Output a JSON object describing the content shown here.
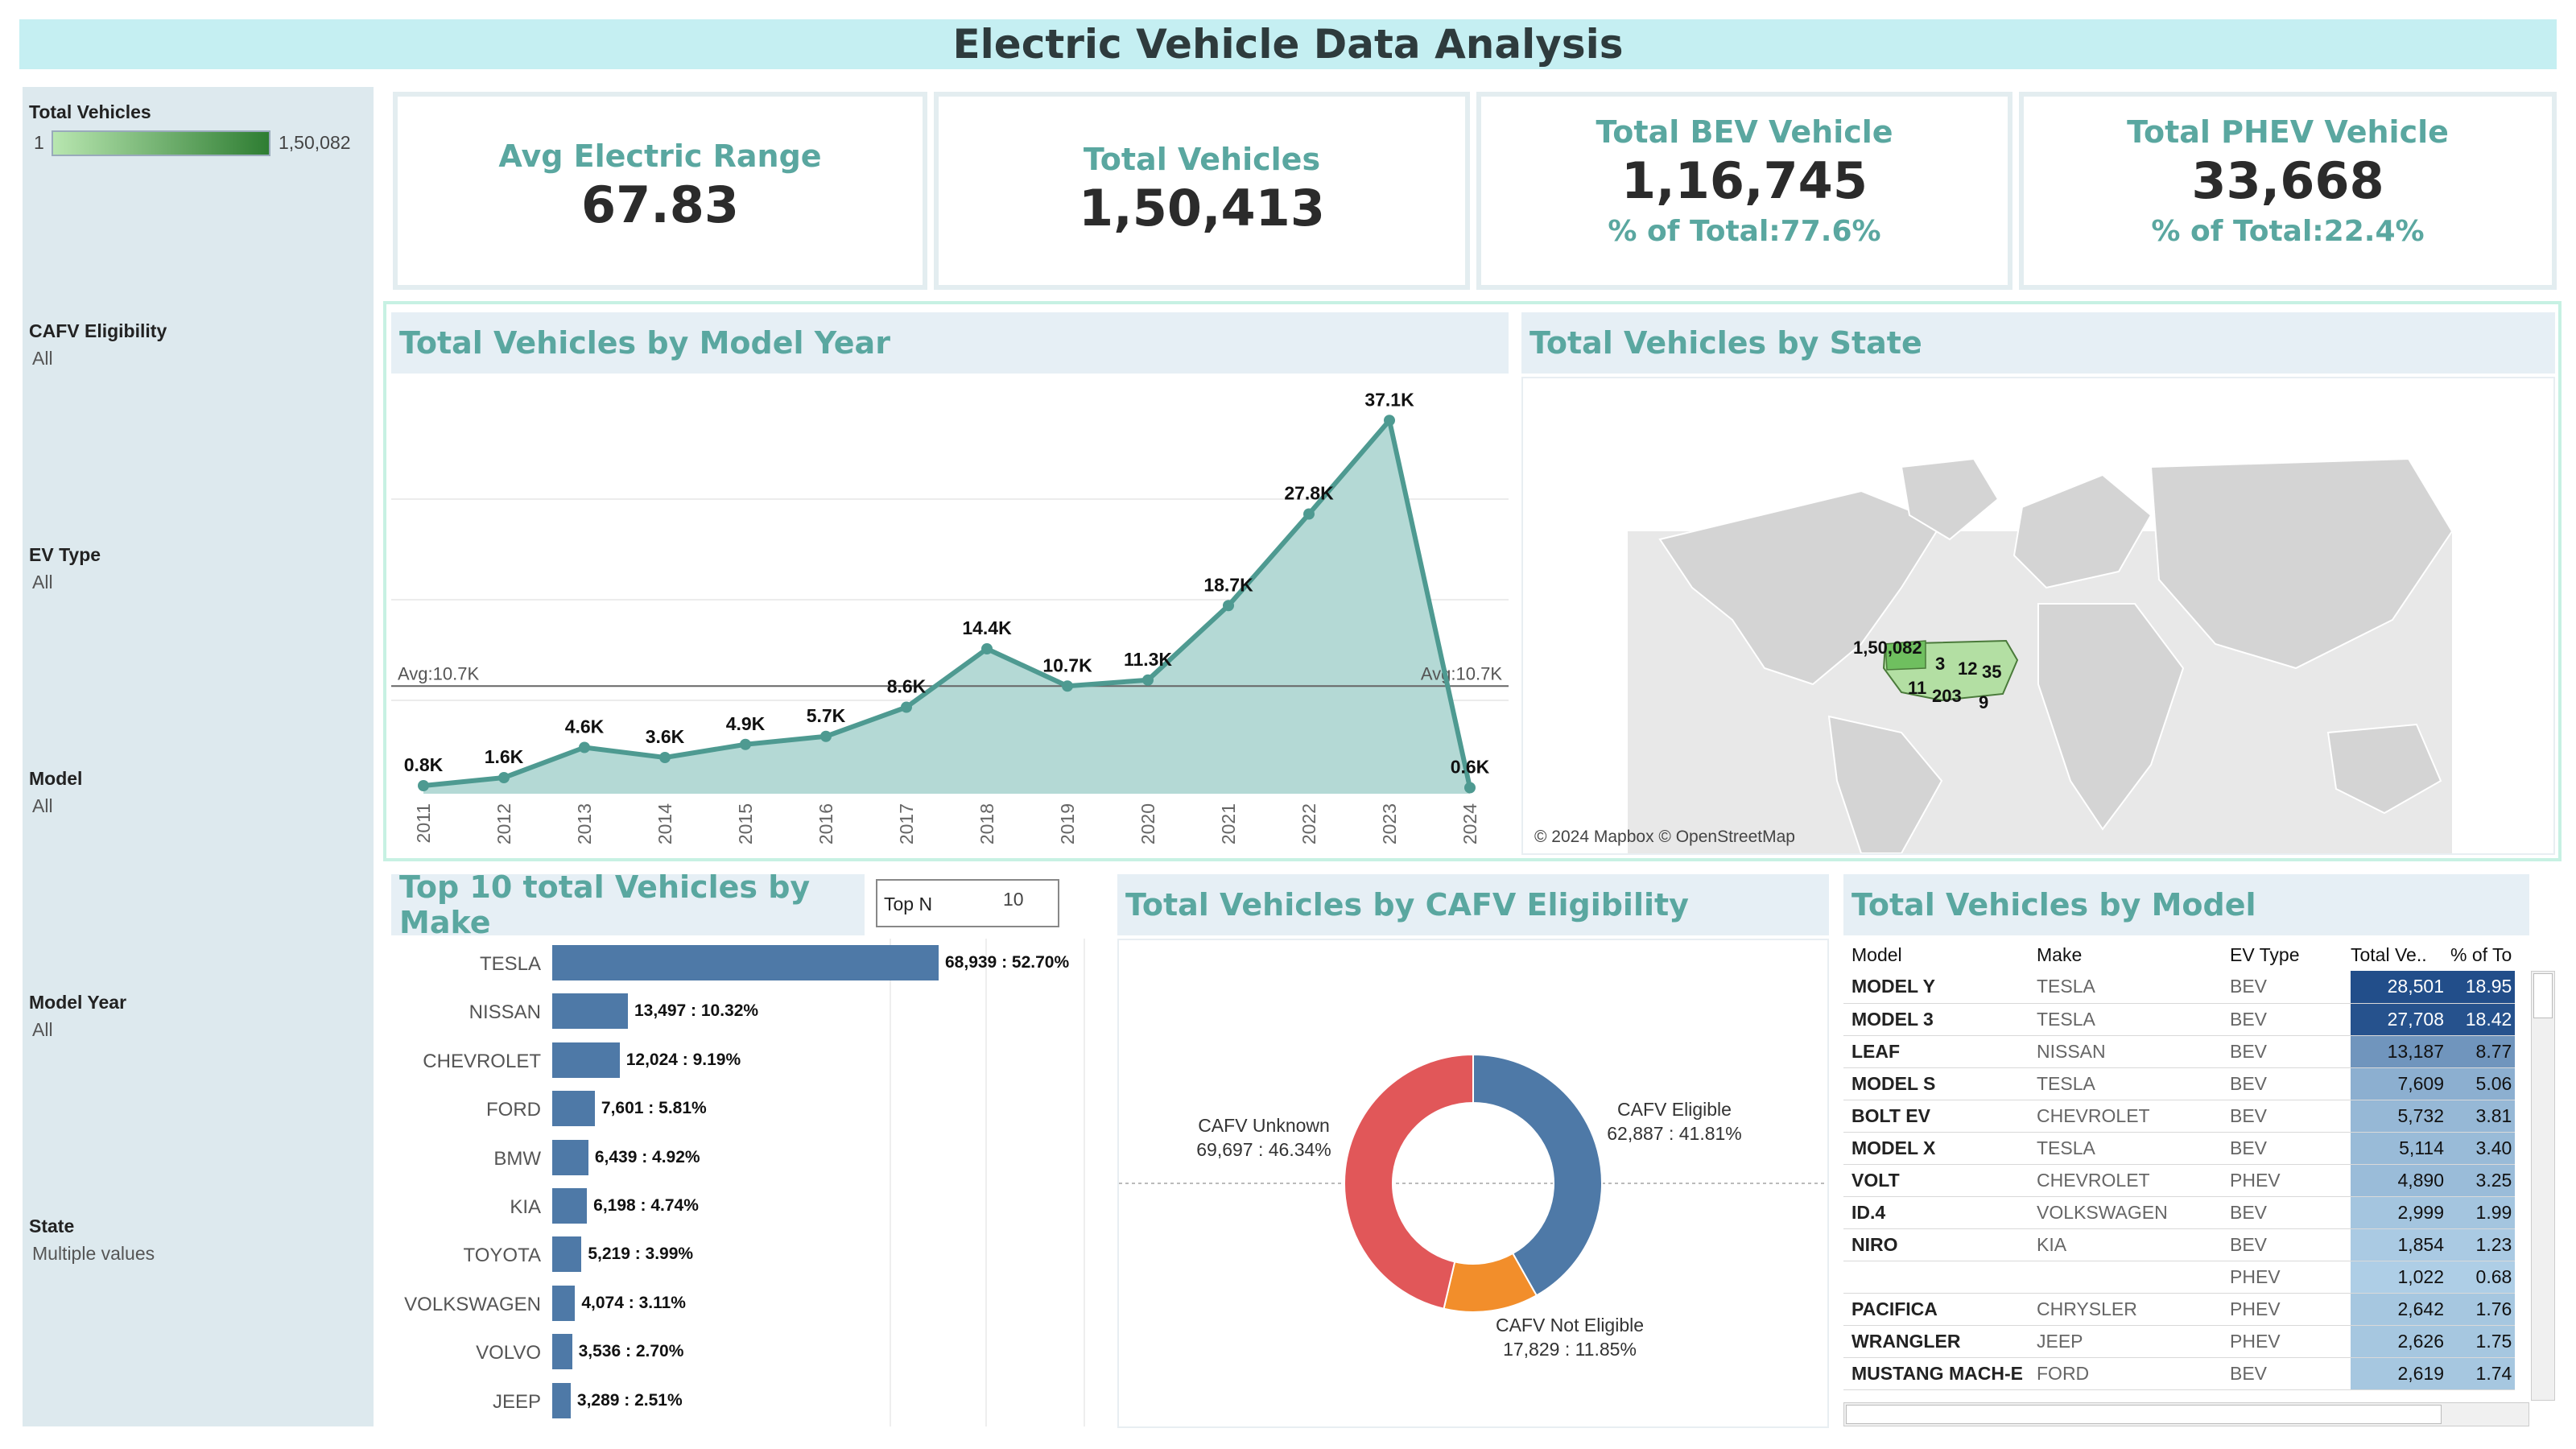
{
  "title": "Electric Vehicle Data Analysis",
  "filters": {
    "legend": {
      "title": "Total Vehicles",
      "min": "1",
      "max": "1,50,082"
    },
    "items": [
      {
        "title": "CAFV Eligibility",
        "value": "All"
      },
      {
        "title": "EV Type",
        "value": "All"
      },
      {
        "title": "Model",
        "value": "All"
      },
      {
        "title": "Model Year",
        "value": "All"
      },
      {
        "title": "State",
        "value": "Multiple values"
      }
    ]
  },
  "kpis": {
    "avg_range": {
      "label": "Avg Electric Range",
      "value": "67.83"
    },
    "total": {
      "label": "Total Vehicles",
      "value": "1,50,413"
    },
    "bev": {
      "label": "Total BEV Vehicle",
      "value": "1,16,745",
      "pct": "% of Total:77.6%"
    },
    "phev": {
      "label": "Total PHEV Vehicle",
      "value": "33,668",
      "pct": "% of Total:22.4%"
    }
  },
  "panels": {
    "by_year": "Total Vehicles by Model Year",
    "by_state": "Total Vehicles by State",
    "by_make": "Top  10 total Vehicles by Make",
    "by_cafv": "Total Vehicles by CAFV Eligibility",
    "by_model": "Total Vehicles by Model"
  },
  "topn": {
    "label": "Top N",
    "value": "10"
  },
  "map": {
    "copyright": "© 2024 Mapbox © OpenStreetMap",
    "labels": [
      "1,50,082",
      "3",
      "12",
      "35",
      "11",
      "203",
      "9"
    ]
  },
  "colors": {
    "line": "#4e9a91",
    "area": "#b4d9d5",
    "bar": "#4e79a7",
    "eligible": "#4e79a7",
    "not_eligible": "#f28e2b",
    "unknown": "#e15759",
    "accent": "#5aa7a0"
  },
  "chart_data": [
    {
      "type": "area",
      "title": "Total Vehicles by Model Year",
      "x": [
        "2011",
        "2012",
        "2013",
        "2014",
        "2015",
        "2016",
        "2017",
        "2018",
        "2019",
        "2020",
        "2021",
        "2022",
        "2023",
        "2024"
      ],
      "values": [
        800,
        1600,
        4600,
        3600,
        4900,
        5700,
        8600,
        14400,
        10700,
        11300,
        18700,
        27800,
        37100,
        600
      ],
      "labels": [
        "0.8K",
        "1.6K",
        "4.6K",
        "3.6K",
        "4.9K",
        "5.7K",
        "8.6K",
        "14.4K",
        "10.7K",
        "11.3K",
        "18.7K",
        "27.8K",
        "37.1K",
        "0.6K"
      ],
      "reference_line": {
        "value": 10700,
        "label": "Avg:10.7K"
      },
      "ylim": [
        0,
        40000
      ],
      "grid": true
    },
    {
      "type": "bar",
      "title": "Top  10 total Vehicles by Make",
      "categories": [
        "TESLA",
        "NISSAN",
        "CHEVROLET",
        "FORD",
        "BMW",
        "KIA",
        "TOYOTA",
        "VOLKSWAGEN",
        "VOLVO",
        "JEEP"
      ],
      "values": [
        68939,
        13497,
        12024,
        7601,
        6439,
        6198,
        5219,
        4074,
        3536,
        3289
      ],
      "labels": [
        "68,939 : 52.70%",
        "13,497 : 10.32%",
        "12,024 : 9.19%",
        "7,601 : 5.81%",
        "6,439 : 4.92%",
        "6,198 : 4.74%",
        "5,219 : 3.99%",
        "4,074 : 3.11%",
        "3,536 : 2.70%",
        "3,289 : 2.51%"
      ]
    },
    {
      "type": "pie",
      "title": "Total Vehicles by CAFV Eligibility",
      "categories": [
        "CAFV Eligible",
        "CAFV Not Eligible",
        "CAFV Unknown"
      ],
      "values": [
        62887,
        17829,
        69697
      ],
      "labels": [
        "62,887 : 41.81%",
        "17,829 : 11.85%",
        "69,697 : 46.34%"
      ]
    },
    {
      "type": "table",
      "title": "Total Vehicles by Model",
      "columns": [
        "Model",
        "Make",
        "EV Type",
        "Total Ve..",
        "% of To"
      ],
      "rows": [
        {
          "model": "MODEL Y",
          "make": "TESLA",
          "type": "BEV",
          "total": "28,501",
          "pct": "18.95",
          "v": 28501
        },
        {
          "model": "MODEL 3",
          "make": "TESLA",
          "type": "BEV",
          "total": "27,708",
          "pct": "18.42",
          "v": 27708
        },
        {
          "model": "LEAF",
          "make": "NISSAN",
          "type": "BEV",
          "total": "13,187",
          "pct": "8.77",
          "v": 13187
        },
        {
          "model": "MODEL S",
          "make": "TESLA",
          "type": "BEV",
          "total": "7,609",
          "pct": "5.06",
          "v": 7609
        },
        {
          "model": "BOLT EV",
          "make": "CHEVROLET",
          "type": "BEV",
          "total": "5,732",
          "pct": "3.81",
          "v": 5732
        },
        {
          "model": "MODEL X",
          "make": "TESLA",
          "type": "BEV",
          "total": "5,114",
          "pct": "3.40",
          "v": 5114
        },
        {
          "model": "VOLT",
          "make": "CHEVROLET",
          "type": "PHEV",
          "total": "4,890",
          "pct": "3.25",
          "v": 4890
        },
        {
          "model": "ID.4",
          "make": "VOLKSWAGEN",
          "type": "BEV",
          "total": "2,999",
          "pct": "1.99",
          "v": 2999
        },
        {
          "model": "NIRO",
          "make": "KIA",
          "type": "BEV",
          "total": "1,854",
          "pct": "1.23",
          "v": 1854
        },
        {
          "model": "",
          "make": "",
          "type": "PHEV",
          "total": "1,022",
          "pct": "0.68",
          "v": 1022
        },
        {
          "model": "PACIFICA",
          "make": "CHRYSLER",
          "type": "PHEV",
          "total": "2,642",
          "pct": "1.76",
          "v": 2642
        },
        {
          "model": "WRANGLER",
          "make": "JEEP",
          "type": "PHEV",
          "total": "2,626",
          "pct": "1.75",
          "v": 2626
        },
        {
          "model": "MUSTANG MACH-E",
          "make": "FORD",
          "type": "BEV",
          "total": "2,619",
          "pct": "1.74",
          "v": 2619
        }
      ]
    }
  ]
}
